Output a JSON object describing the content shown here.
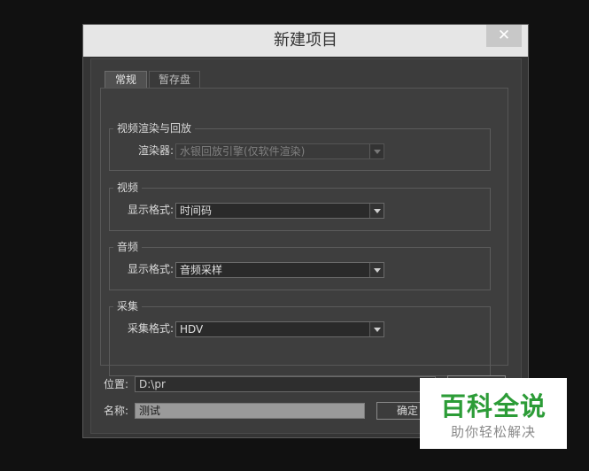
{
  "dialog": {
    "title": "新建项目",
    "close_label": "✕"
  },
  "tabs": [
    {
      "label": "常规",
      "active": true
    },
    {
      "label": "暂存盘",
      "active": false
    }
  ],
  "render_group": {
    "legend": "视频渲染与回放",
    "renderer_label": "渲染器:",
    "renderer_value": "水银回放引擎(仅软件渲染)",
    "disabled": true
  },
  "video_group": {
    "legend": "视频",
    "format_label": "显示格式:",
    "format_value": "时间码"
  },
  "audio_group": {
    "legend": "音频",
    "format_label": "显示格式:",
    "format_value": "音频采样"
  },
  "capture_group": {
    "legend": "采集",
    "format_label": "采集格式:",
    "format_value": "HDV"
  },
  "location": {
    "label": "位置:",
    "value": "D:\\pr"
  },
  "name": {
    "label": "名称:",
    "value": "测试"
  },
  "buttons": {
    "ok_label": "确定"
  },
  "watermark": {
    "main": "百科全说",
    "sub": "助你轻松解决"
  },
  "colors": {
    "dialog_bg": "#353535",
    "titlebar_bg": "#e6e6e6",
    "watermark_green": "#2c9c37"
  }
}
